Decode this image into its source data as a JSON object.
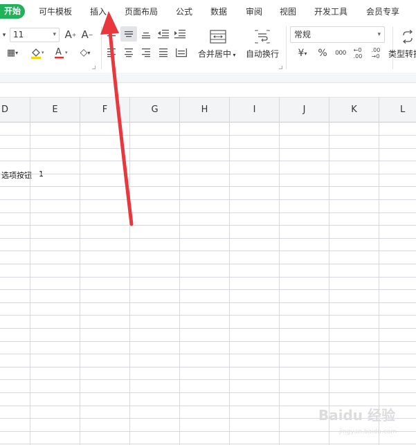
{
  "menu": {
    "items": [
      "开始",
      "可牛模板",
      "插入",
      "页面布局",
      "公式",
      "数据",
      "审阅",
      "视图",
      "开发工具",
      "会员专享"
    ]
  },
  "ribbon": {
    "font_size": "11",
    "number_format": "常规",
    "merge_label": "合并居中",
    "wrap_label": "自动换行",
    "type_convert_label": "类型转换",
    "percent_symbol": "%",
    "currency_symbol": "¥",
    "thousands_symbol": "000",
    "dec_increase": "←0\n.00",
    "dec_decrease": ".00\n→0"
  },
  "sheet": {
    "columns": [
      "D",
      "E",
      "F",
      "G",
      "H",
      "I",
      "J",
      "K",
      "L"
    ],
    "cells": [
      {
        "text": "选项按钮",
        "col": "D",
        "row": 5
      },
      {
        "text": "1",
        "col": "E",
        "row": 5
      }
    ]
  },
  "watermark": {
    "brand": "Baidu 经验",
    "sub": "jingyan.baidu.com"
  },
  "colors": {
    "accent": "#1fb25a",
    "arrow": "#e8383d",
    "grid": "#d5d8e3",
    "header_bg": "#f3f4f6"
  }
}
